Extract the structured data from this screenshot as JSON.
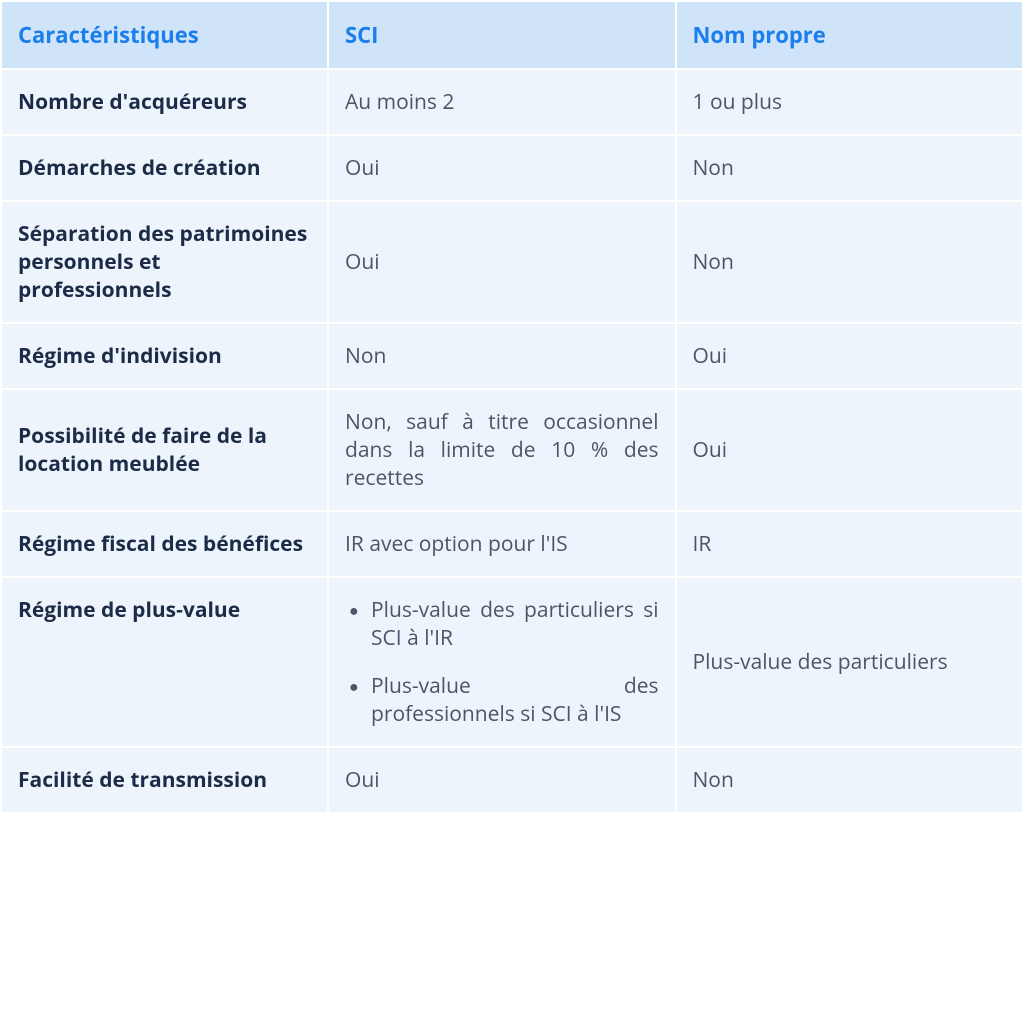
{
  "headers": {
    "col1": "Caractéristiques",
    "col2": "SCI",
    "col3": "Nom propre"
  },
  "rows": [
    {
      "label": "Nombre d'acquéreurs",
      "sci": "Au moins 2",
      "nom_propre": "1 ou plus"
    },
    {
      "label": "Démarches de création",
      "sci": "Oui",
      "nom_propre": "Non"
    },
    {
      "label": "Séparation des patrimoines personnels et professionnels",
      "sci": "Oui",
      "nom_propre": "Non"
    },
    {
      "label": "Régime d'indivision",
      "sci": "Non",
      "nom_propre": "Oui"
    },
    {
      "label": "Possibilité de faire de la location meublée",
      "sci": "Non, sauf à titre occasionnel dans la limite de 10 % des recettes",
      "nom_propre": "Oui"
    },
    {
      "label": "Régime fiscal des bénéfices",
      "sci": "IR avec option pour l'IS",
      "nom_propre": "IR"
    },
    {
      "label": "Régime de plus-value",
      "sci_bullets": [
        "Plus-value des particuliers si SCI à l'IR",
        "Plus-value des professionnels si SCI à l'IS"
      ],
      "nom_propre": "Plus-value des particuliers"
    },
    {
      "label": "Facilité de transmission",
      "sci": "Oui",
      "nom_propre": "Non"
    }
  ]
}
